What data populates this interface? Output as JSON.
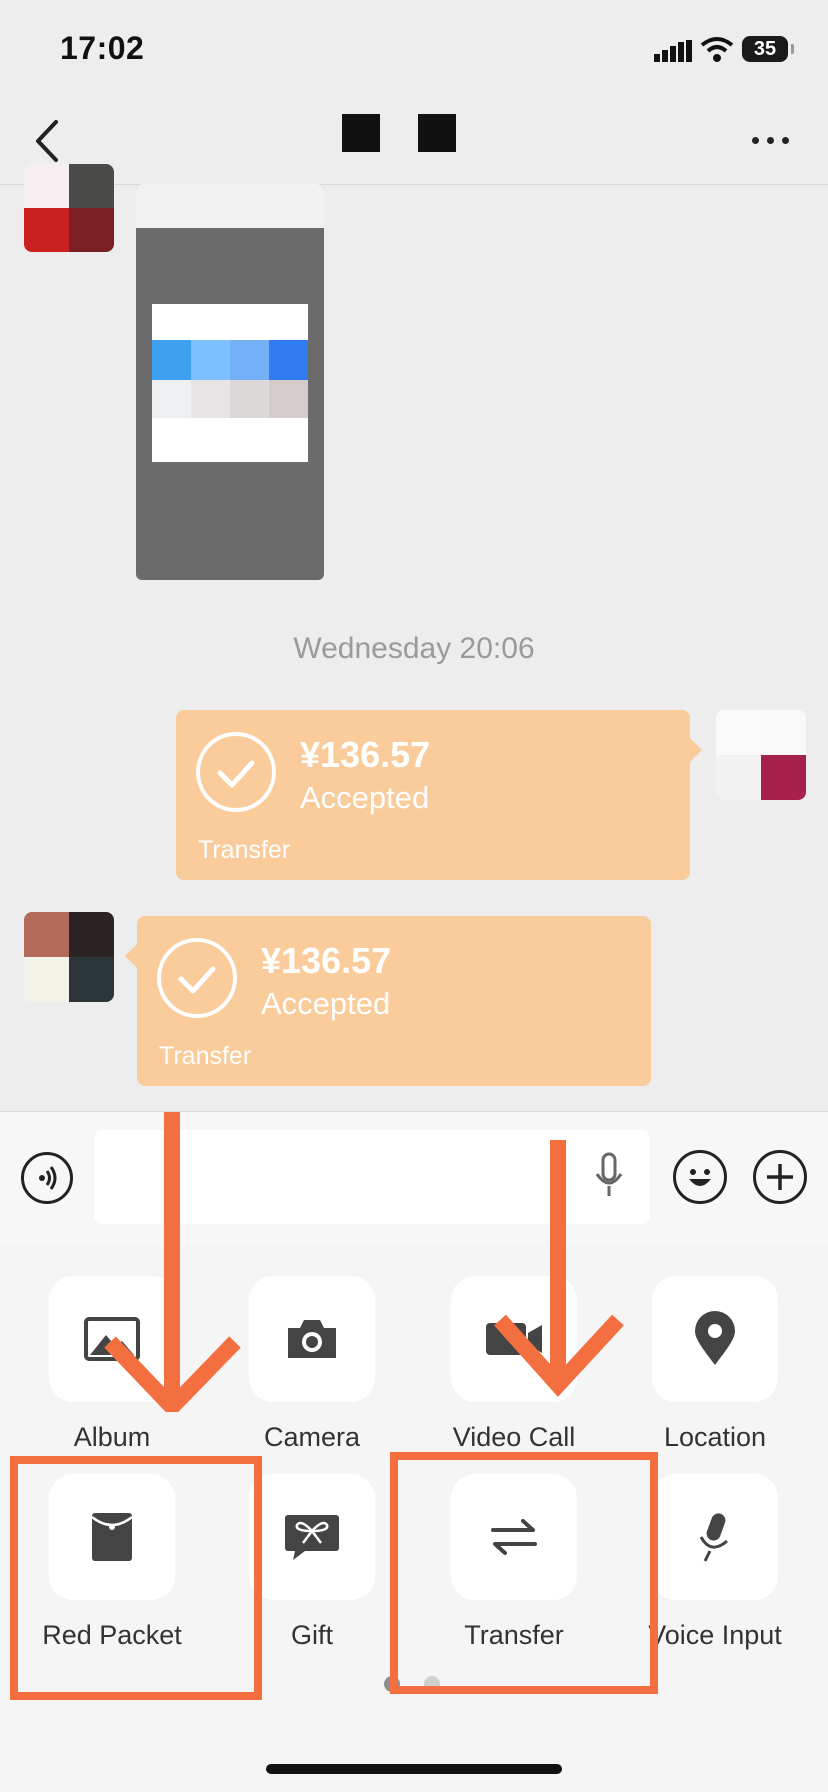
{
  "status_bar": {
    "time": "17:02",
    "battery": "35"
  },
  "chat": {
    "timestamp": "Wednesday 20:06",
    "messages": [
      {
        "type": "transfer",
        "side": "right",
        "amount": "¥136.57",
        "status": "Accepted",
        "label": "Transfer"
      },
      {
        "type": "transfer",
        "side": "left",
        "amount": "¥136.57",
        "status": "Accepted",
        "label": "Transfer"
      }
    ]
  },
  "panel": {
    "items": [
      {
        "label": "Album",
        "icon": "album-icon"
      },
      {
        "label": "Camera",
        "icon": "camera-icon"
      },
      {
        "label": "Video Call",
        "icon": "video-call-icon"
      },
      {
        "label": "Location",
        "icon": "location-icon"
      },
      {
        "label": "Red Packet",
        "icon": "red-packet-icon"
      },
      {
        "label": "Gift",
        "icon": "gift-icon"
      },
      {
        "label": "Transfer",
        "icon": "transfer-icon"
      },
      {
        "label": "Voice Input",
        "icon": "voice-input-icon"
      }
    ]
  },
  "colors": {
    "transfer_bubble": "#fbcc9b",
    "annotation": "#f36f3f",
    "chat_bg": "#ededed"
  }
}
